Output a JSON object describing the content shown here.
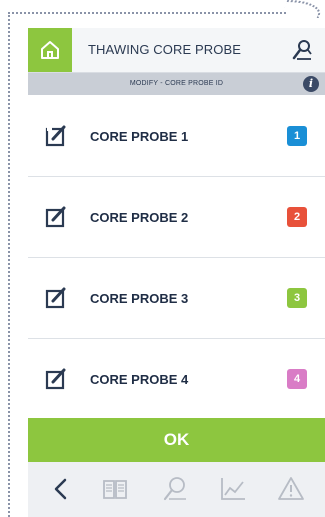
{
  "header": {
    "title": "THAWING CORE PROBE",
    "home_icon": "home-icon",
    "probe_icon": "core-probe-icon"
  },
  "subheader": {
    "text": "MODIFY - CORE PROBE ID",
    "info_icon": "info-icon"
  },
  "probes": [
    {
      "label": "CORE PROBE 1",
      "badge": "1",
      "color": "#1a8fd6"
    },
    {
      "label": "CORE PROBE 2",
      "badge": "2",
      "color": "#e8513a"
    },
    {
      "label": "CORE PROBE 3",
      "badge": "3",
      "color": "#8dc63f"
    },
    {
      "label": "CORE PROBE 4",
      "badge": "4",
      "color": "#d97cc6"
    }
  ],
  "ok_button": "OK",
  "footer": {
    "icons": [
      "back-icon",
      "recipe-book-icon",
      "probe-icon",
      "chart-icon",
      "warning-icon"
    ]
  },
  "colors": {
    "accent_green": "#8dc63f",
    "text_dark": "#1f2d45",
    "footer_bg": "#eef0f3"
  }
}
